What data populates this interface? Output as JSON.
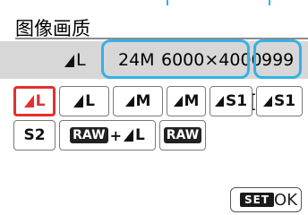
{
  "header": {
    "title": "图像画质"
  },
  "info": {
    "quality": "L",
    "megapixels": "24M",
    "resolution": "6000×4000",
    "bracket": "[",
    "shots": "999"
  },
  "options": {
    "row1": [
      "L",
      "L",
      "M",
      "M",
      "S1",
      "S1"
    ],
    "row2_s2": "S2",
    "raw_label": "RAW",
    "raw_plus": "+",
    "raw_plus_quality": "L"
  },
  "footer": {
    "set_label": "SET",
    "ok_label": "OK"
  },
  "colors": {
    "callout": "#34b1e6",
    "selected": "#e23030",
    "info_bar": "#d7d7d7"
  }
}
